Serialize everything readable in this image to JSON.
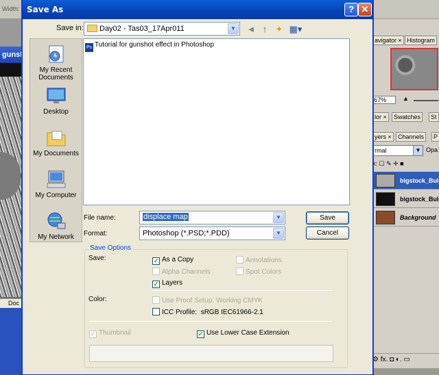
{
  "background": {
    "toolbar_label": "Width:",
    "doc_title": "gunsh",
    "doc_status": "Doc",
    "right_panel": {
      "tabs_top": [
        "avigator ×",
        "Histogram"
      ],
      "zoom": "67%",
      "tabs_mid": [
        "lor ×",
        "Swatches",
        "St"
      ],
      "tabs_layers": [
        "yers ×",
        "Channels",
        "P"
      ],
      "blend_mode": "rmal",
      "opacity_label": "Opa",
      "lock_label": "k:",
      "layers": [
        {
          "name": "bigstock_Bulle",
          "active": true
        },
        {
          "name": "bigstock_Bulle",
          "active": false
        },
        {
          "name": "Background",
          "active": false
        }
      ],
      "bottom_icons": "⚙ fx. ◘ ◐. ▭"
    }
  },
  "dialog": {
    "title": "Save As",
    "help_label": "?",
    "close_label": "✕",
    "save_in_label": "Save in:",
    "save_in_value": "Day02 - Tas03_17Apr011",
    "toolbar_icons": {
      "back": "◄",
      "up": "↑",
      "new_folder": "✦",
      "views": "▦▾"
    },
    "places": [
      {
        "label": "My Recent Documents",
        "icon": "recent-documents-icon"
      },
      {
        "label": "Desktop",
        "icon": "desktop-icon"
      },
      {
        "label": "My Documents",
        "icon": "my-documents-icon"
      },
      {
        "label": "My Computer",
        "icon": "my-computer-icon"
      },
      {
        "label": "My Network",
        "icon": "my-network-icon"
      }
    ],
    "files": [
      {
        "name": "Tutorial for gunshot effect in Photoshop",
        "icon_text": "Ps"
      }
    ],
    "file_name_label": "File name:",
    "file_name_value": "displace map",
    "format_label": "Format:",
    "format_value": "Photoshop (*.PSD;*.PDD)",
    "save_button": "Save",
    "cancel_button": "Cancel",
    "save_options": {
      "legend": "Save Options",
      "save_label": "Save:",
      "as_a_copy": "As a Copy",
      "annotations": "Annotations",
      "alpha_channels": "Alpha Channels",
      "spot_colors": "Spot Colors",
      "layers": "Layers",
      "color_label": "Color:",
      "use_proof_setup": "Use Proof Setup:",
      "proof_value": "Working CMYK",
      "icc_profile": "ICC Profile:",
      "icc_value": "sRGB IEC61966-2.1",
      "thumbnail": "Thumbnail",
      "use_lower_case": "Use Lower Case Extension"
    }
  }
}
